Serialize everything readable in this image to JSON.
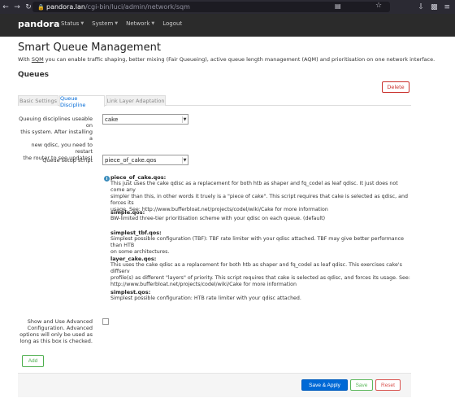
{
  "browser": {
    "url_host": "pandora.lan",
    "url_path": "/cgi-bin/luci/admin/network/sqm"
  },
  "header": {
    "brand": "pandora",
    "menu": [
      {
        "label": "Status"
      },
      {
        "label": "System"
      },
      {
        "label": "Network"
      },
      {
        "label": "Logout"
      }
    ]
  },
  "page": {
    "title": "Smart Queue Management",
    "desc_prefix": "With ",
    "desc_sqm": "SQM",
    "desc_rest": " you can enable traffic shaping, better mixing (Fair Queueing), active queue length management (AQM) and prioritisation on one network interface.",
    "section_title": "Queues",
    "delete_label": "Delete"
  },
  "tabs": [
    {
      "label": "Basic Settings",
      "active": false
    },
    {
      "label": "Queue Discipline",
      "active": true
    },
    {
      "label": "Link Layer Adaptation",
      "active": false
    }
  ],
  "form": {
    "qdisc_label_1": "Queuing disciplines useable on",
    "qdisc_label_2": "this system. After installing a",
    "qdisc_label_3": "new qdisc, you need to restart",
    "qdisc_label_4": "the router to see updates!",
    "qdisc_value": "cake",
    "script_label": "Queue setup script",
    "script_value": "piece_of_cake.qos",
    "advanced_label_1": "Show and Use Advanced",
    "advanced_label_2": "Configuration. Advanced",
    "advanced_label_3": "options will only be used as",
    "advanced_label_4": "long as this box is checked.",
    "add_label": "Add"
  },
  "help": [
    {
      "name": "piece_of_cake.qos:",
      "lines": [
        "This just uses the cake qdisc as a replacement for both htb as shaper and fq_codel as leaf qdisc. It just does not come any",
        "simpler than this, in other words it truely is a \"piece of cake\". This script requires that cake is selected as qdisc, and forces its",
        "usage. See: http://www.bufferbloat.net/projects/codel/wiki/Cake for more information"
      ]
    },
    {
      "name": "simple.qos:",
      "lines": [
        "BW-limited three-tier prioritisation scheme with your qdisc on each queue. (default)"
      ]
    },
    {
      "name": "simplest_tbf.qos:",
      "lines": [
        "Simplest possible configuration (TBF): TBF rate limiter with your qdisc attached. TBF may give better performance than HTB",
        "on some architectures."
      ]
    },
    {
      "name": "layer_cake.qos:",
      "lines": [
        "This uses the cake qdisc as a replacement for both htb as shaper and fq_codel as leaf qdisc. This exercises cake's diffserv",
        "profile(s) as different \"layers\" of priority. This script requires that cake is selected as qdisc, and forces its usage. See:",
        "http://www.bufferbloat.net/projects/codel/wiki/Cake for more information"
      ]
    },
    {
      "name": "simplest.qos:",
      "lines": [
        "Simplest possible configuration: HTB rate limiter with your qdisc attached."
      ]
    }
  ],
  "footer": {
    "apply_label": "Save & Apply",
    "save_label": "Save",
    "reset_label": "Reset"
  }
}
